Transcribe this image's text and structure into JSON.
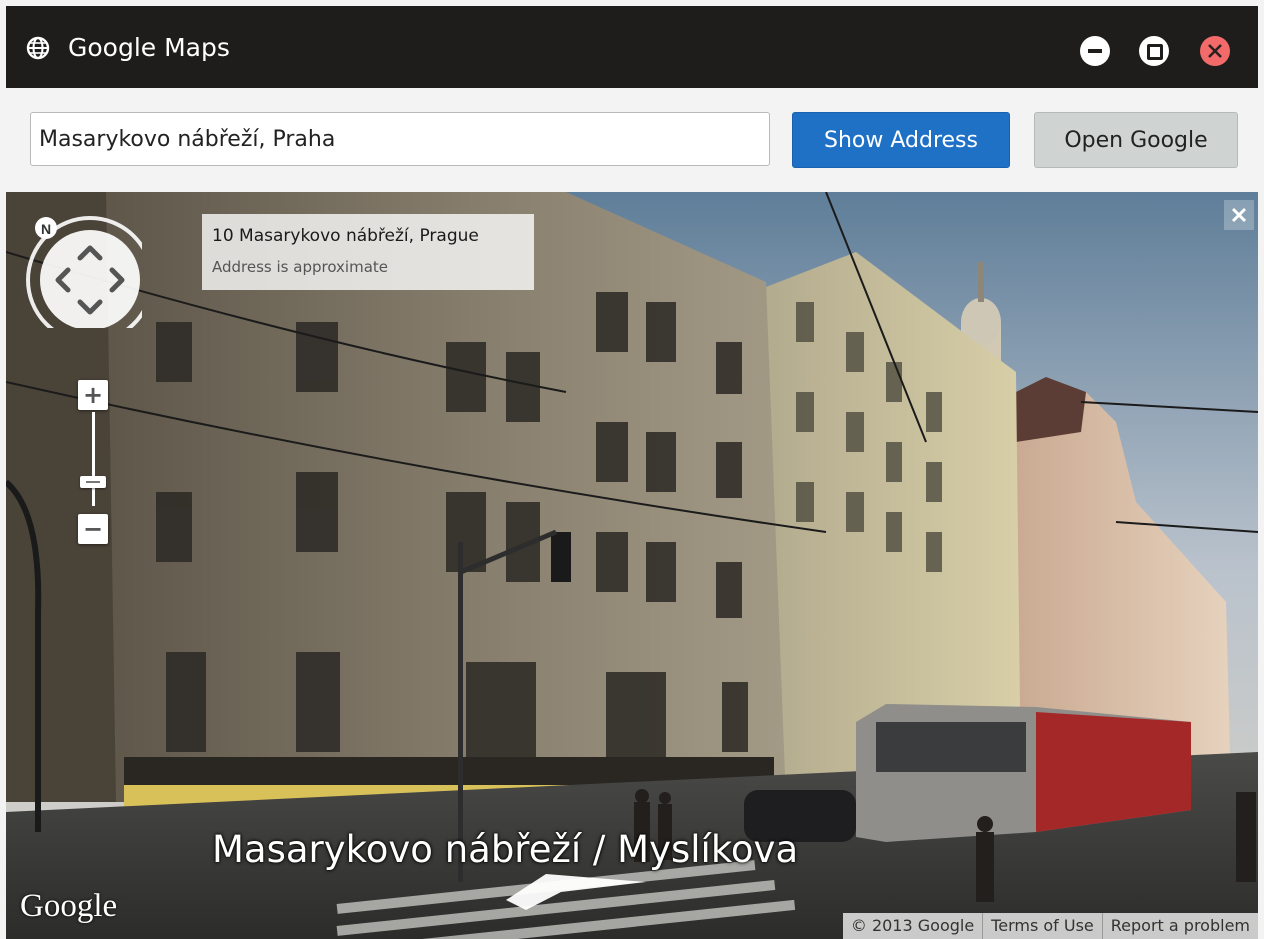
{
  "window": {
    "title": "Google Maps",
    "icon": "globe-icon"
  },
  "toolbar": {
    "address_value": "Masarykovo nábřeží, Praha",
    "show_address_label": "Show Address",
    "open_google_label": "Open Google"
  },
  "street_view": {
    "address_title": "10 Masarykovo nábřeží, Prague",
    "address_note": "Address is approximate",
    "street_label": "Masarykovo nábřeží / Myslíkova",
    "google_logo": "Google",
    "compass_letter": "N",
    "zoom_in_label": "+",
    "zoom_out_label": "−",
    "footer": {
      "copyright": "© 2013 Google",
      "terms": "Terms of Use",
      "report": "Report a problem"
    }
  },
  "colors": {
    "titlebar": "#1f1d1c",
    "primary_button": "#1f71c6",
    "secondary_button": "#cfd4d2",
    "close_button": "#f26a6a"
  }
}
